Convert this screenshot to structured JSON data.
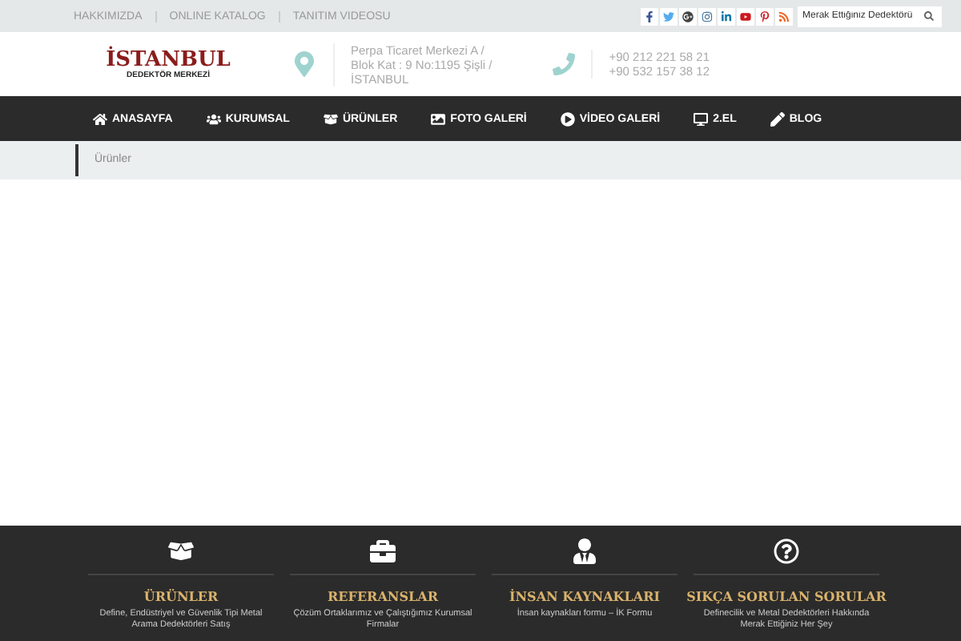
{
  "top_links": [
    "HAKKIMIZDA",
    "ONLINE KATALOG",
    "TANITIM VIDEOSU"
  ],
  "social_icons": [
    {
      "kind": "facebook"
    },
    {
      "kind": "twitter"
    },
    {
      "kind": "google"
    },
    {
      "kind": "instagram"
    },
    {
      "kind": "linkedin"
    },
    {
      "kind": "youtube"
    },
    {
      "kind": "pinterest"
    },
    {
      "kind": "rss"
    }
  ],
  "search": {
    "placeholder": "Merak Ettiğiniz Dedektörü"
  },
  "logo": {
    "title": "İSTANBUL",
    "subtitle": "DEDEKTÖR MERKEZİ"
  },
  "address": [
    "Perpa Ticaret Merkezi A /",
    "Blok Kat : 9 No:1195 Şişli /",
    "İSTANBUL"
  ],
  "phones": [
    "+90 212 221 58 21",
    "+90 532 157 38 12"
  ],
  "nav": [
    "ANASAYFA",
    "KURUMSAL",
    "ÜRÜNLER",
    "FOTO GALERİ",
    "VİDEO GALERİ",
    "2.EL",
    "BLOG"
  ],
  "breadcrumb": "Ürünler",
  "footer_cards": [
    {
      "title": "ÜRÜNLER",
      "text": "Define, Endüstriyel ve Güvenlik Tipi Metal Arama Dedektörleri Satış"
    },
    {
      "title": "REFERANSLAR",
      "text": "Çözüm Ortaklarımız ve Çalıştığımız Kurumsal Firmalar"
    },
    {
      "title": "İNSAN KAYNAKLARI",
      "text": "İnsan kaynakları formu – İK Formu"
    },
    {
      "title": "SIKÇA SORULAN SORULAR",
      "text": "Definecilik ve Metal Dedektörleri Hakkında Merak Ettiğiniz Her Şey"
    }
  ]
}
